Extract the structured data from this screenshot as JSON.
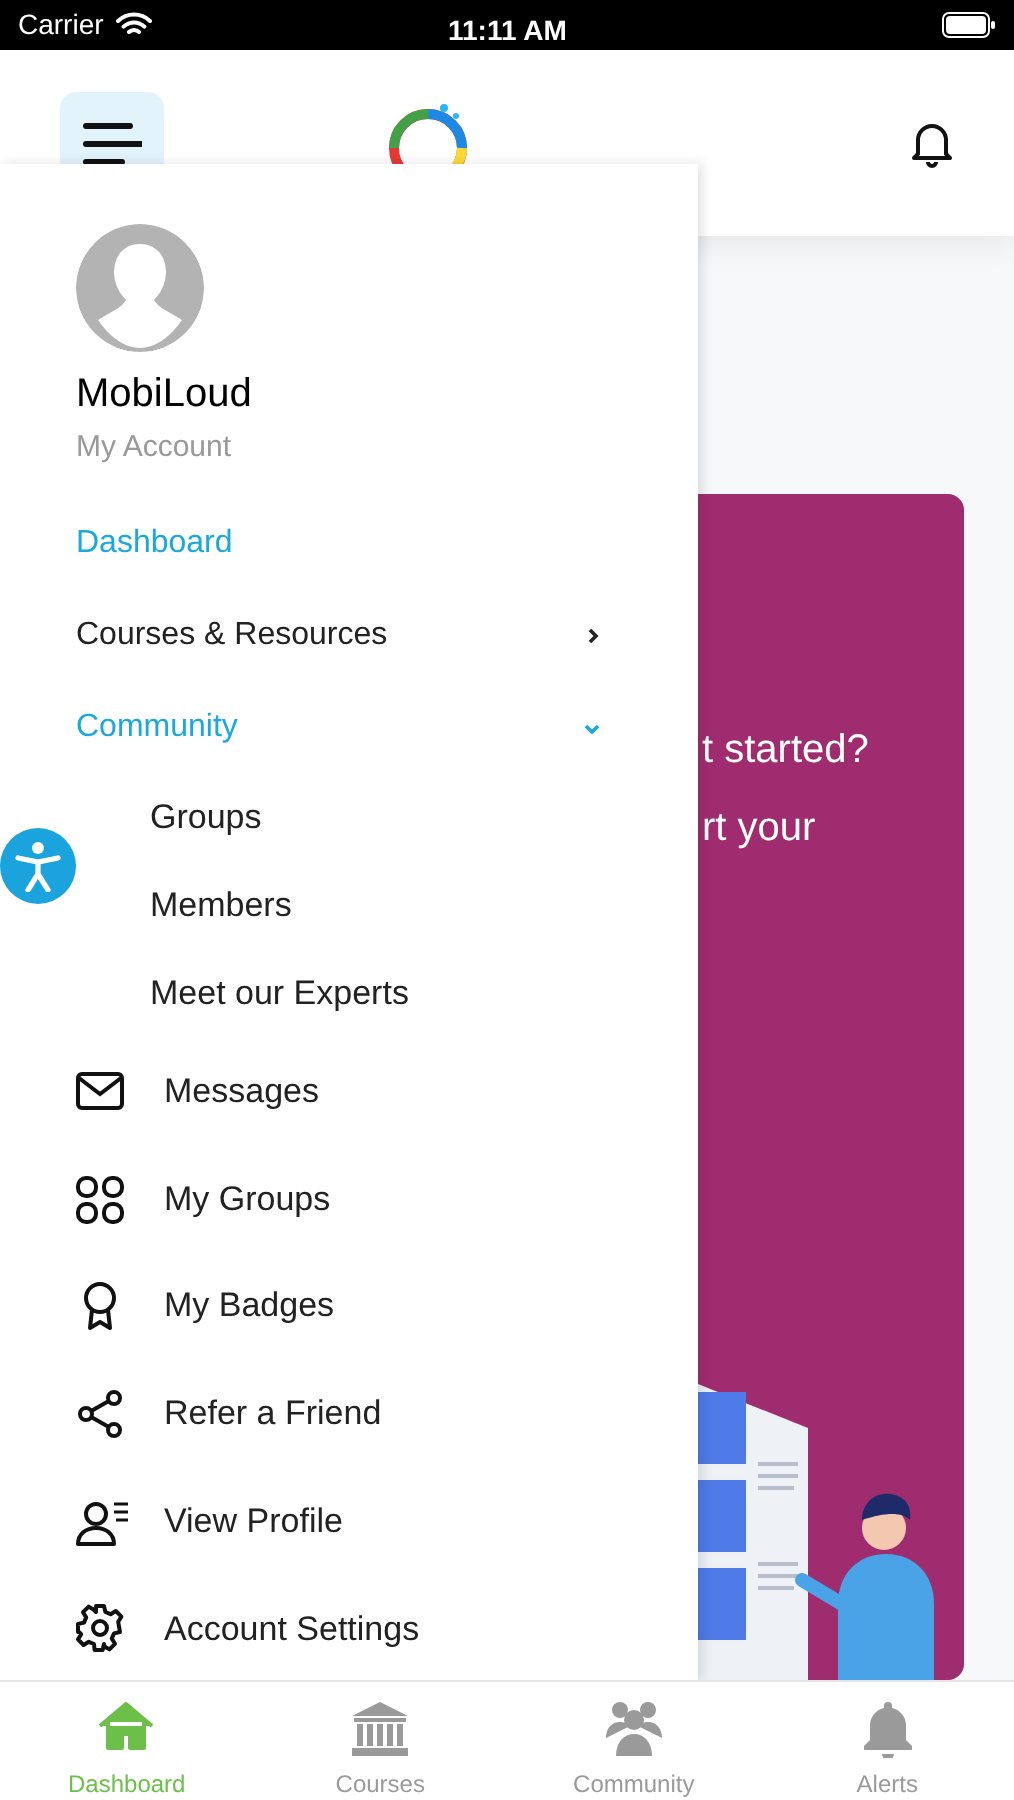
{
  "status_bar": {
    "carrier": "Carrier",
    "time": "11:11 AM"
  },
  "banner": {
    "lines": [
      "t started?",
      "rt your"
    ]
  },
  "drawer": {
    "user": {
      "name": "MobiLoud",
      "subtitle": "My Account"
    },
    "menu": [
      {
        "label": "Dashboard",
        "selected": true
      },
      {
        "label": "Courses & Resources",
        "selected": false,
        "expanded": false
      },
      {
        "label": "Community",
        "expanded": true,
        "children": [
          {
            "label": "Groups"
          },
          {
            "label": "Members"
          },
          {
            "label": "Meet our Experts"
          }
        ]
      }
    ],
    "links": [
      {
        "label": "Messages",
        "kind": "envelope"
      },
      {
        "label": "My Groups",
        "kind": "grid"
      },
      {
        "label": "My Badges",
        "kind": "badge"
      },
      {
        "label": "Refer a Friend",
        "kind": "share"
      },
      {
        "label": "View Profile",
        "kind": "profile"
      },
      {
        "label": "Account Settings",
        "kind": "gear"
      }
    ]
  },
  "tab_bar": [
    {
      "label": "Dashboard",
      "kind": "home",
      "selected": true
    },
    {
      "label": "Courses",
      "kind": "bank",
      "selected": false
    },
    {
      "label": "Community",
      "kind": "people",
      "selected": false
    },
    {
      "label": "Alerts",
      "kind": "bell",
      "selected": false
    }
  ]
}
